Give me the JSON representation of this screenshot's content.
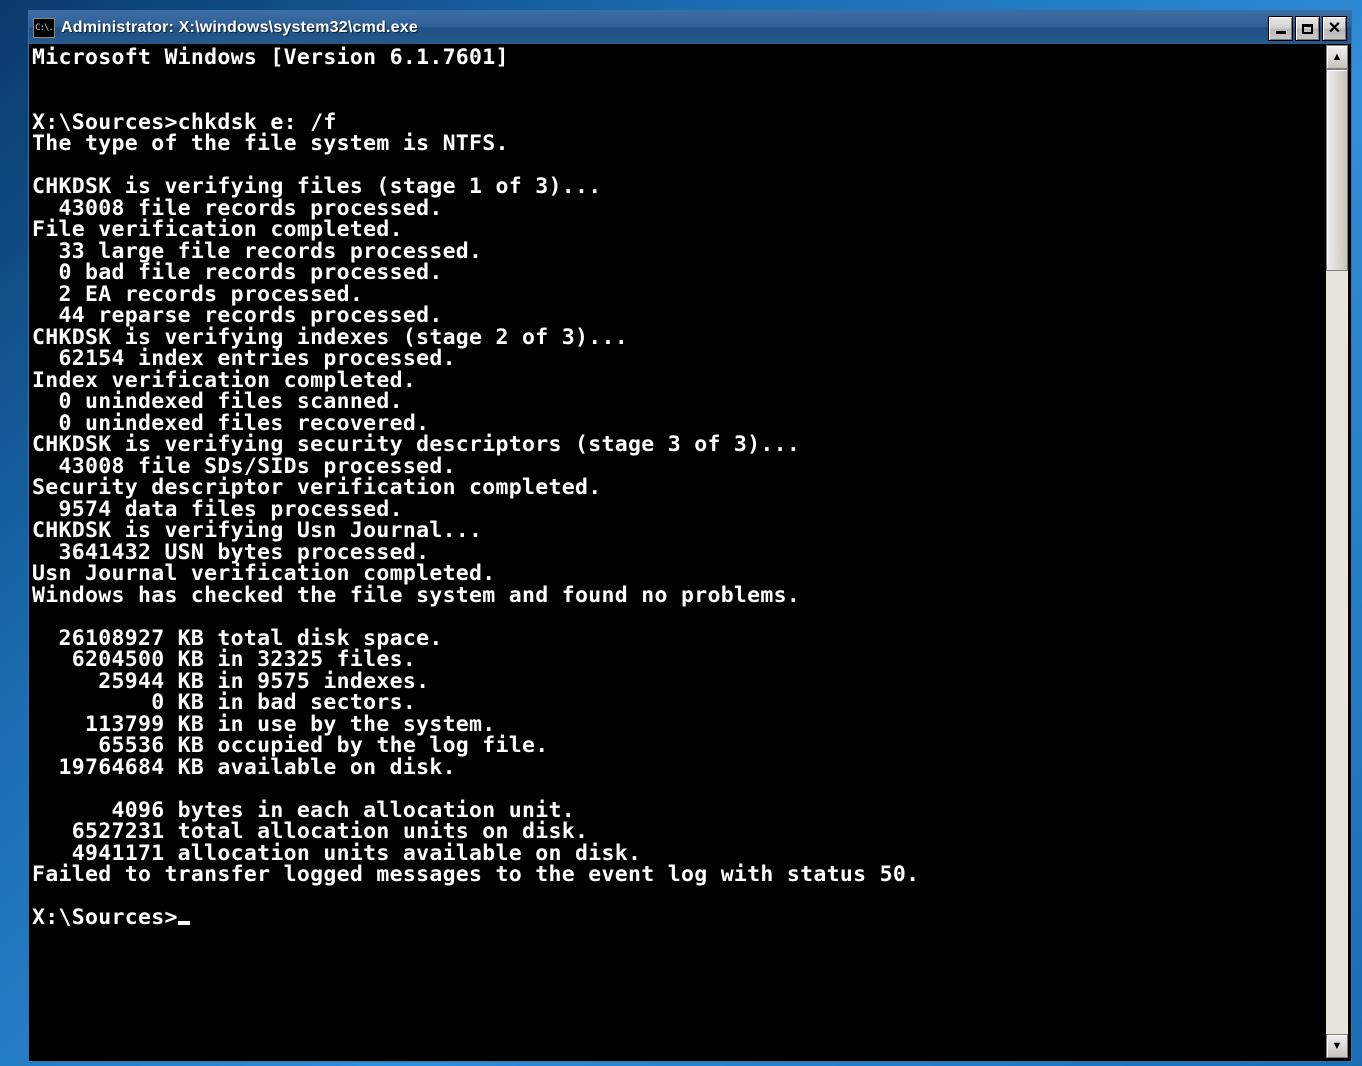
{
  "window": {
    "title": "Administrator: X:\\windows\\system32\\cmd.exe",
    "sysmenu_label": "C:\\."
  },
  "console": {
    "lines": [
      "Microsoft Windows [Version 6.1.7601]",
      "",
      "",
      "X:\\Sources>chkdsk e: /f",
      "The type of the file system is NTFS.",
      "",
      "CHKDSK is verifying files (stage 1 of 3)...",
      "  43008 file records processed.",
      "File verification completed.",
      "  33 large file records processed.",
      "  0 bad file records processed.",
      "  2 EA records processed.",
      "  44 reparse records processed.",
      "CHKDSK is verifying indexes (stage 2 of 3)...",
      "  62154 index entries processed.",
      "Index verification completed.",
      "  0 unindexed files scanned.",
      "  0 unindexed files recovered.",
      "CHKDSK is verifying security descriptors (stage 3 of 3)...",
      "  43008 file SDs/SIDs processed.",
      "Security descriptor verification completed.",
      "  9574 data files processed.",
      "CHKDSK is verifying Usn Journal...",
      "  3641432 USN bytes processed.",
      "Usn Journal verification completed.",
      "Windows has checked the file system and found no problems.",
      "",
      "  26108927 KB total disk space.",
      "   6204500 KB in 32325 files.",
      "     25944 KB in 9575 indexes.",
      "         0 KB in bad sectors.",
      "    113799 KB in use by the system.",
      "     65536 KB occupied by the log file.",
      "  19764684 KB available on disk.",
      "",
      "      4096 bytes in each allocation unit.",
      "   6527231 total allocation units on disk.",
      "   4941171 allocation units available on disk.",
      "Failed to transfer logged messages to the event log with status 50.",
      ""
    ],
    "prompt": "X:\\Sources>"
  }
}
